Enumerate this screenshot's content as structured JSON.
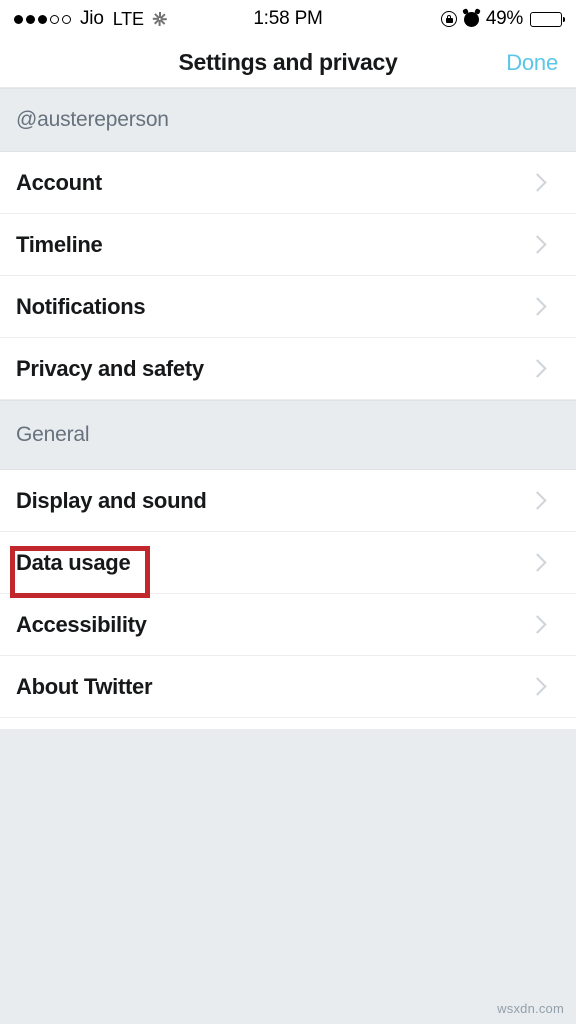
{
  "status_bar": {
    "signal_dots_filled": 3,
    "signal_dots_total": 5,
    "carrier": "Jio",
    "network_type": "LTE",
    "activity_indicator_icon": "spinner-icon",
    "time": "1:58 PM",
    "rotation_lock_icon": "rotation-lock-icon",
    "alarm_icon": "alarm-clock-icon",
    "battery_percent_label": "49%",
    "battery_level": 49
  },
  "nav_bar": {
    "title": "Settings and privacy",
    "done_label": "Done",
    "done_color": "#5bc7e8"
  },
  "sections": [
    {
      "header": "@austereperson",
      "rows": [
        {
          "label": "Account",
          "chevron_icon": "chevron-right-icon"
        },
        {
          "label": "Timeline",
          "chevron_icon": "chevron-right-icon"
        },
        {
          "label": "Notifications",
          "chevron_icon": "chevron-right-icon"
        },
        {
          "label": "Privacy and safety",
          "chevron_icon": "chevron-right-icon"
        }
      ]
    },
    {
      "header": "General",
      "rows": [
        {
          "label": "Display and sound",
          "chevron_icon": "chevron-right-icon"
        },
        {
          "label": "Data usage",
          "chevron_icon": "chevron-right-icon"
        },
        {
          "label": "Accessibility",
          "chevron_icon": "chevron-right-icon"
        },
        {
          "label": "About Twitter",
          "chevron_icon": "chevron-right-icon"
        }
      ]
    }
  ],
  "annotation": {
    "target_row_label": "Data usage",
    "color": "#c1272d"
  },
  "footer": {
    "watermark": "wsxdn.com"
  }
}
